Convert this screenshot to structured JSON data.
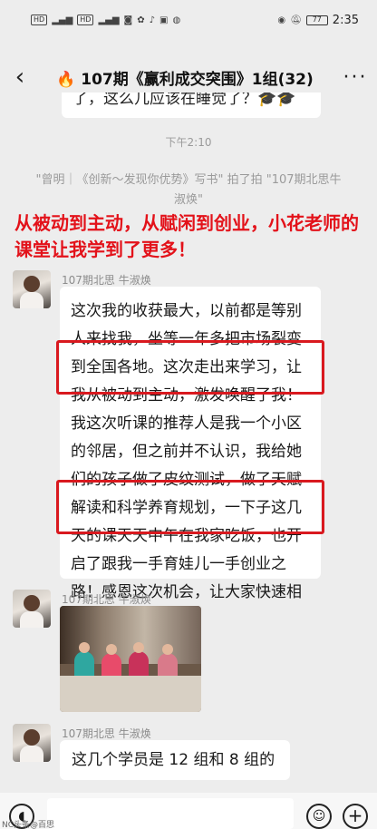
{
  "status_bar": {
    "left_labels": [
      "HD",
      "4G",
      "HD",
      "4G"
    ],
    "time": "2:35",
    "battery": "77"
  },
  "header": {
    "back_icon": "chevron-left-icon",
    "title": "🔥 107期《赢利成交突围》1组(32)",
    "more_icon": "more-dots-icon"
  },
  "previous_message": {
    "text": "了，这么几应该在睡觉了？🎓🎓"
  },
  "time_separator": "下午2:10",
  "system_message": "\"曾明｜《创新～发现你优势》写书\" 拍了拍 \"107期北思牛淑焕\"",
  "red_overlay": "从被动到主动，从赋闲到创业，小花老师的课堂让我学到了更多！",
  "messages": [
    {
      "sender": "107期北思 牛淑焕",
      "text": "这次我的收获最大，以前都是等别人来找我，坐等一年多把市场裂变到全国各地。这次走出来学习，让我从被动到主动，激发唤醒了我！我这次听课的推荐人是我一个小区的邻居，但之前并不认识，我给她们的孩子做了皮纹测试，做了天赋解读和科学养育规划，一下子这几天的课天天中午在我家吃饭，也开启了跟我一手育娃儿一手创业之路！感恩这次机会，让大家快速相互帮助！😊🌹"
    },
    {
      "sender": "107期北思 牛淑焕",
      "type": "image"
    },
    {
      "sender": "107期北思 牛淑焕",
      "text": "这几个学员是 12 组和 8 组的"
    }
  ],
  "input_bar": {
    "voice_icon": "voice-icon",
    "emoji_icon": "emoji-icon",
    "plus_icon": "plus-icon"
  },
  "watermark": "NC头条@百思"
}
